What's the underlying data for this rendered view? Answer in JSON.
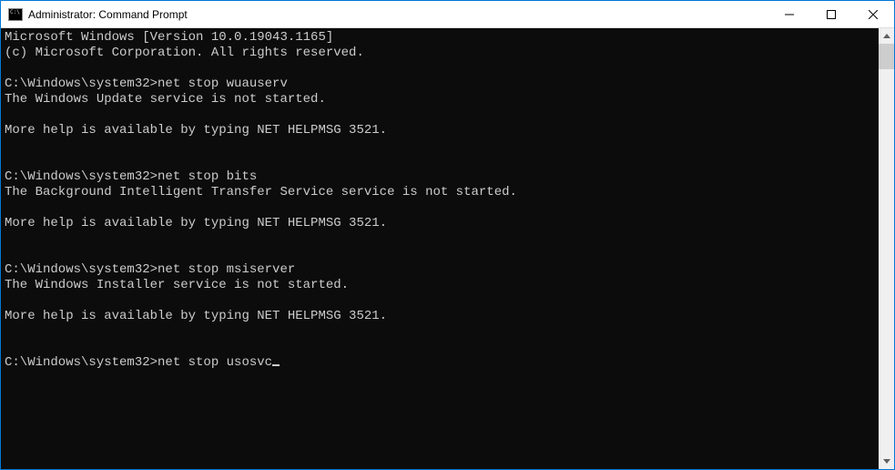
{
  "titlebar": {
    "title": "Administrator: Command Prompt"
  },
  "console": {
    "lines": [
      "Microsoft Windows [Version 10.0.19043.1165]",
      "(c) Microsoft Corporation. All rights reserved.",
      "",
      "C:\\Windows\\system32>net stop wuauserv",
      "The Windows Update service is not started.",
      "",
      "More help is available by typing NET HELPMSG 3521.",
      "",
      "",
      "C:\\Windows\\system32>net stop bits",
      "The Background Intelligent Transfer Service service is not started.",
      "",
      "More help is available by typing NET HELPMSG 3521.",
      "",
      "",
      "C:\\Windows\\system32>net stop msiserver",
      "The Windows Installer service is not started.",
      "",
      "More help is available by typing NET HELPMSG 3521.",
      "",
      "",
      "C:\\Windows\\system32>net stop usosvc"
    ],
    "current_prompt": "C:\\Windows\\system32>",
    "current_input": "net stop usosvc"
  }
}
